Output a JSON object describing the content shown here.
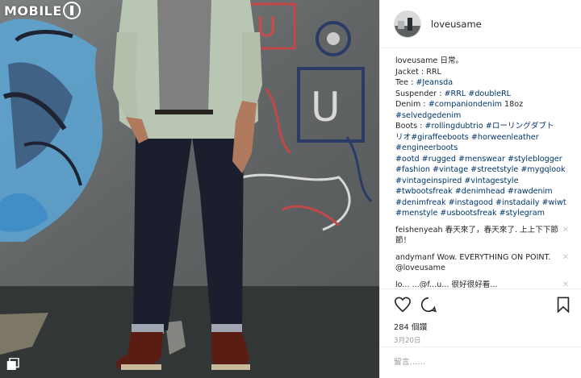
{
  "watermark": {
    "text": "MOBILE",
    "suffix": "1"
  },
  "post": {
    "username": "loveusame",
    "caption_user": "loveusame",
    "caption_lines": [
      [
        {
          "t": "日常。",
          "tag": false
        }
      ],
      [
        {
          "t": "Jacket : RRL",
          "tag": false
        }
      ],
      [
        {
          "t": "Tee : ",
          "tag": false
        },
        {
          "t": "#Jeansda",
          "tag": true
        }
      ],
      [
        {
          "t": "Suspender : ",
          "tag": false
        },
        {
          "t": "#RRL #doubleRL",
          "tag": true
        }
      ],
      [
        {
          "t": "Denim : ",
          "tag": false
        },
        {
          "t": "#companiondenim",
          "tag": true
        },
        {
          "t": " 18oz",
          "tag": false
        }
      ],
      [
        {
          "t": "#selvedgedenim",
          "tag": true
        }
      ],
      [
        {
          "t": "Boots : ",
          "tag": false
        },
        {
          "t": "#rollingdubtrio #ローリングダブト",
          "tag": true
        }
      ],
      [
        {
          "t": "リオ",
          "tag": true
        },
        {
          "t": "#giraffeeboots #horweenleather",
          "tag": true
        }
      ],
      [
        {
          "t": "#engineerboots",
          "tag": true
        }
      ],
      [
        {
          "t": "#ootd #rugged #menswear #styleblogger",
          "tag": true
        }
      ],
      [
        {
          "t": "#fashion #vintage #streetstyle #mygqlook",
          "tag": true
        }
      ],
      [
        {
          "t": "#vintageinspired #vintagestyle",
          "tag": true
        }
      ],
      [
        {
          "t": "#twbootsfreak #denimhead #rawdenim",
          "tag": true
        }
      ],
      [
        {
          "t": "#denimfreak #instagood #instadaily #wiwt",
          "tag": true
        }
      ],
      [
        {
          "t": "#menstyle #usbootsfreak #stylegram",
          "tag": true
        }
      ]
    ],
    "comments": [
      {
        "user": "feishenyeah",
        "text": "春天來了，春天來了. 上上下下節節！"
      },
      {
        "user": "andymanf",
        "text": "Wow. EVERYTHING ON POINT. @loveusame"
      },
      {
        "user": "lo...",
        "text": "...@f...u... 很好很好看..."
      }
    ],
    "likes": "284 個讚",
    "date": "3月20日",
    "add_comment_placeholder": "留言……"
  },
  "icons": {
    "like": "heart-icon",
    "comment": "comment-icon",
    "save": "bookmark-icon",
    "more": "close-icon",
    "multi": "multiple-photos-icon"
  }
}
